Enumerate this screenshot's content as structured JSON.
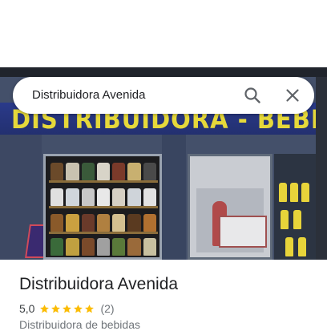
{
  "search": {
    "query": "Distribuidora Avenida",
    "search_icon": "search-icon",
    "close_icon": "close-icon"
  },
  "photo": {
    "sign_text": "DISTRIBUIDORA - BEBIDAS"
  },
  "place": {
    "name": "Distribuidora Avenida",
    "rating": "5,0",
    "stars": 5,
    "review_count": "(2)",
    "category": "Distribuidora de bebidas"
  },
  "colors": {
    "star": "#fbbc04",
    "sign_text": "#e6d93a"
  }
}
